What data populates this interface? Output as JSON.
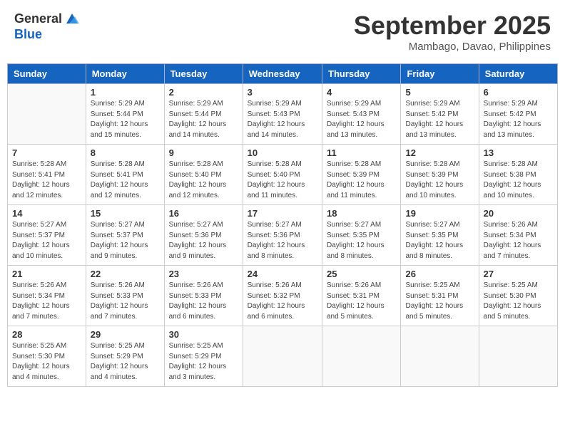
{
  "header": {
    "logo_general": "General",
    "logo_blue": "Blue",
    "month_title": "September 2025",
    "location": "Mambago, Davao, Philippines"
  },
  "calendar": {
    "days_of_week": [
      "Sunday",
      "Monday",
      "Tuesday",
      "Wednesday",
      "Thursday",
      "Friday",
      "Saturday"
    ],
    "weeks": [
      [
        {
          "day": "",
          "info": ""
        },
        {
          "day": "1",
          "info": "Sunrise: 5:29 AM\nSunset: 5:44 PM\nDaylight: 12 hours\nand 15 minutes."
        },
        {
          "day": "2",
          "info": "Sunrise: 5:29 AM\nSunset: 5:44 PM\nDaylight: 12 hours\nand 14 minutes."
        },
        {
          "day": "3",
          "info": "Sunrise: 5:29 AM\nSunset: 5:43 PM\nDaylight: 12 hours\nand 14 minutes."
        },
        {
          "day": "4",
          "info": "Sunrise: 5:29 AM\nSunset: 5:43 PM\nDaylight: 12 hours\nand 13 minutes."
        },
        {
          "day": "5",
          "info": "Sunrise: 5:29 AM\nSunset: 5:42 PM\nDaylight: 12 hours\nand 13 minutes."
        },
        {
          "day": "6",
          "info": "Sunrise: 5:29 AM\nSunset: 5:42 PM\nDaylight: 12 hours\nand 13 minutes."
        }
      ],
      [
        {
          "day": "7",
          "info": "Sunrise: 5:28 AM\nSunset: 5:41 PM\nDaylight: 12 hours\nand 12 minutes."
        },
        {
          "day": "8",
          "info": "Sunrise: 5:28 AM\nSunset: 5:41 PM\nDaylight: 12 hours\nand 12 minutes."
        },
        {
          "day": "9",
          "info": "Sunrise: 5:28 AM\nSunset: 5:40 PM\nDaylight: 12 hours\nand 12 minutes."
        },
        {
          "day": "10",
          "info": "Sunrise: 5:28 AM\nSunset: 5:40 PM\nDaylight: 12 hours\nand 11 minutes."
        },
        {
          "day": "11",
          "info": "Sunrise: 5:28 AM\nSunset: 5:39 PM\nDaylight: 12 hours\nand 11 minutes."
        },
        {
          "day": "12",
          "info": "Sunrise: 5:28 AM\nSunset: 5:39 PM\nDaylight: 12 hours\nand 10 minutes."
        },
        {
          "day": "13",
          "info": "Sunrise: 5:28 AM\nSunset: 5:38 PM\nDaylight: 12 hours\nand 10 minutes."
        }
      ],
      [
        {
          "day": "14",
          "info": "Sunrise: 5:27 AM\nSunset: 5:37 PM\nDaylight: 12 hours\nand 10 minutes."
        },
        {
          "day": "15",
          "info": "Sunrise: 5:27 AM\nSunset: 5:37 PM\nDaylight: 12 hours\nand 9 minutes."
        },
        {
          "day": "16",
          "info": "Sunrise: 5:27 AM\nSunset: 5:36 PM\nDaylight: 12 hours\nand 9 minutes."
        },
        {
          "day": "17",
          "info": "Sunrise: 5:27 AM\nSunset: 5:36 PM\nDaylight: 12 hours\nand 8 minutes."
        },
        {
          "day": "18",
          "info": "Sunrise: 5:27 AM\nSunset: 5:35 PM\nDaylight: 12 hours\nand 8 minutes."
        },
        {
          "day": "19",
          "info": "Sunrise: 5:27 AM\nSunset: 5:35 PM\nDaylight: 12 hours\nand 8 minutes."
        },
        {
          "day": "20",
          "info": "Sunrise: 5:26 AM\nSunset: 5:34 PM\nDaylight: 12 hours\nand 7 minutes."
        }
      ],
      [
        {
          "day": "21",
          "info": "Sunrise: 5:26 AM\nSunset: 5:34 PM\nDaylight: 12 hours\nand 7 minutes."
        },
        {
          "day": "22",
          "info": "Sunrise: 5:26 AM\nSunset: 5:33 PM\nDaylight: 12 hours\nand 7 minutes."
        },
        {
          "day": "23",
          "info": "Sunrise: 5:26 AM\nSunset: 5:33 PM\nDaylight: 12 hours\nand 6 minutes."
        },
        {
          "day": "24",
          "info": "Sunrise: 5:26 AM\nSunset: 5:32 PM\nDaylight: 12 hours\nand 6 minutes."
        },
        {
          "day": "25",
          "info": "Sunrise: 5:26 AM\nSunset: 5:31 PM\nDaylight: 12 hours\nand 5 minutes."
        },
        {
          "day": "26",
          "info": "Sunrise: 5:25 AM\nSunset: 5:31 PM\nDaylight: 12 hours\nand 5 minutes."
        },
        {
          "day": "27",
          "info": "Sunrise: 5:25 AM\nSunset: 5:30 PM\nDaylight: 12 hours\nand 5 minutes."
        }
      ],
      [
        {
          "day": "28",
          "info": "Sunrise: 5:25 AM\nSunset: 5:30 PM\nDaylight: 12 hours\nand 4 minutes."
        },
        {
          "day": "29",
          "info": "Sunrise: 5:25 AM\nSunset: 5:29 PM\nDaylight: 12 hours\nand 4 minutes."
        },
        {
          "day": "30",
          "info": "Sunrise: 5:25 AM\nSunset: 5:29 PM\nDaylight: 12 hours\nand 3 minutes."
        },
        {
          "day": "",
          "info": ""
        },
        {
          "day": "",
          "info": ""
        },
        {
          "day": "",
          "info": ""
        },
        {
          "day": "",
          "info": ""
        }
      ]
    ]
  }
}
